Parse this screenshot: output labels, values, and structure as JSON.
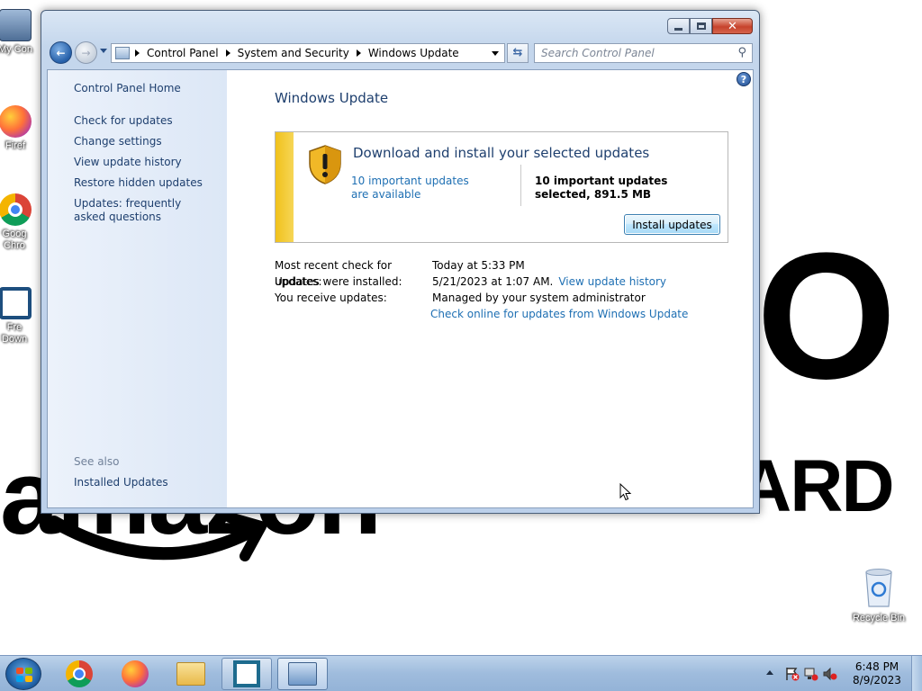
{
  "desktop": {
    "wallpaper": {
      "big_text": "O",
      "word_left": "amazon",
      "word_right": "ARD"
    },
    "icons": [
      {
        "name": "computer",
        "label": "My Con"
      },
      {
        "name": "firefox",
        "label": "Firef"
      },
      {
        "name": "chrome",
        "label": "Goog Chro"
      },
      {
        "name": "free-download-manager",
        "label": "Fre Down"
      }
    ],
    "recycle_bin_label": "Recycle Bin"
  },
  "window": {
    "caption_buttons": {
      "minimize": "minimize",
      "maximize": "maximize",
      "close": "✕"
    },
    "address": {
      "crumbs": [
        "Control Panel",
        "System and Security",
        "Windows Update"
      ]
    },
    "search_placeholder": "Search Control Panel",
    "help_label": "?",
    "left_pane": {
      "home": "Control Panel Home",
      "links": [
        "Check for updates",
        "Change settings",
        "View update history",
        "Restore hidden updates",
        "Updates: frequently asked questions"
      ],
      "see_also": "See also",
      "installed_updates": "Installed Updates"
    },
    "main": {
      "title": "Windows Update",
      "banner": {
        "heading": "Download and install your selected updates",
        "available_link": "10 important updates are available",
        "selected_text": "10 important updates selected, 891.5 MB",
        "install_button": "Install updates",
        "accent_color": "#f0c11c"
      },
      "info": {
        "recent_check_label": "Most recent check for updates:",
        "recent_check_value": "Today at 5:33 PM",
        "installed_label": "Updates were installed:",
        "installed_value": "5/21/2023 at 1:07 AM.",
        "history_link": "View update history",
        "receive_label": "You receive updates:",
        "receive_value": "Managed by your system administrator",
        "online_link": "Check online for updates from Windows Update"
      }
    }
  },
  "taskbar": {
    "items": [
      {
        "name": "chrome",
        "state": "normal"
      },
      {
        "name": "firefox",
        "state": "normal"
      },
      {
        "name": "file-explorer",
        "state": "normal"
      },
      {
        "name": "free-download-manager",
        "state": "open"
      },
      {
        "name": "control-panel",
        "state": "active"
      }
    ],
    "clock": {
      "time": "6:48 PM",
      "date": "8/9/2023"
    }
  }
}
